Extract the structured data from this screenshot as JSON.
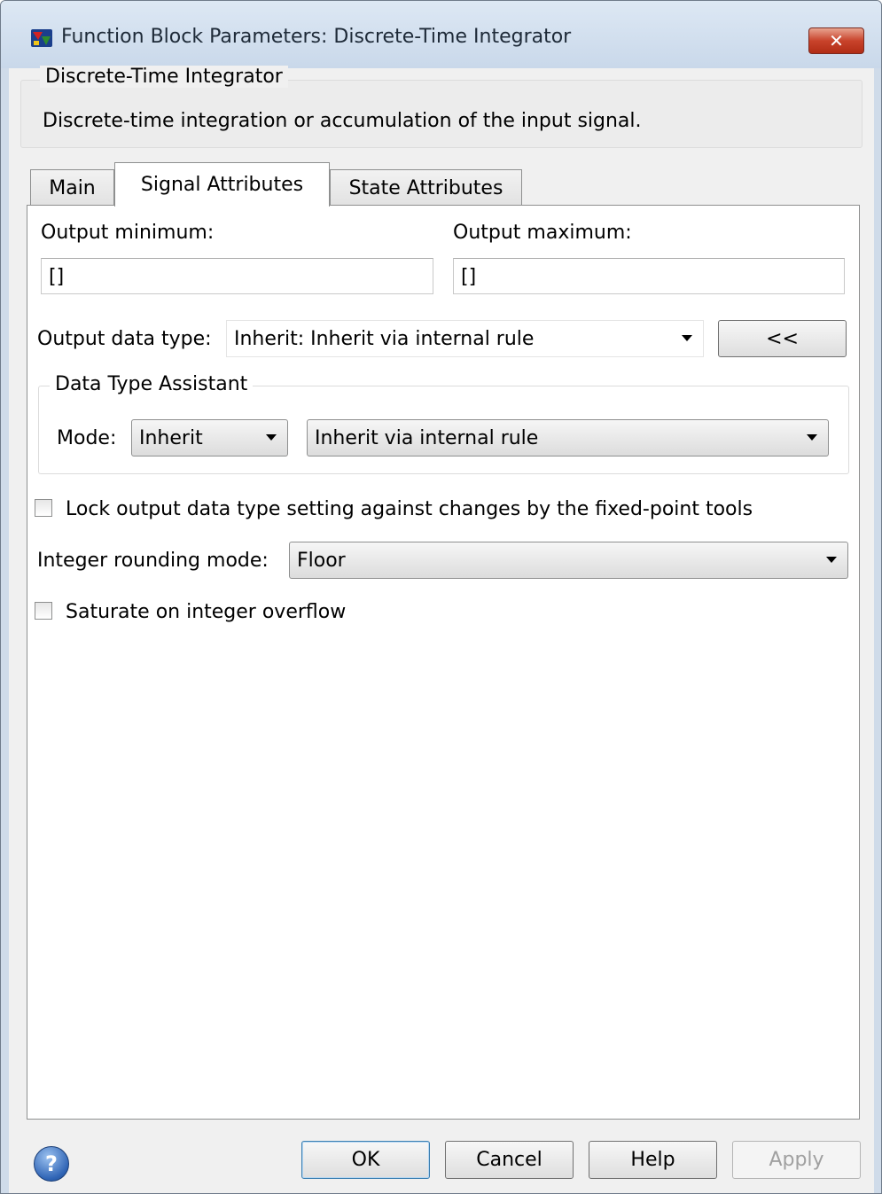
{
  "window": {
    "title": "Function Block Parameters: Discrete-Time Integrator",
    "close_glyph": "✕",
    "icon": "simulink-block-icon"
  },
  "description": {
    "group_label": "Discrete-Time Integrator",
    "text": "Discrete-time integration or accumulation of the input signal."
  },
  "tabs": [
    {
      "label": "Main",
      "active": false
    },
    {
      "label": "Signal Attributes",
      "active": true
    },
    {
      "label": "State Attributes",
      "active": false
    }
  ],
  "signal": {
    "output_min_label": "Output minimum:",
    "output_min_value": "[]",
    "output_max_label": "Output maximum:",
    "output_max_value": "[]",
    "output_dtype_label": "Output data type:",
    "output_dtype_value": "Inherit: Inherit via internal rule",
    "assistant_toggle_label": "<<",
    "assistant": {
      "label": "Data Type Assistant",
      "mode_label": "Mode:",
      "mode_value": "Inherit",
      "rule_value": "Inherit via internal rule"
    },
    "lock_label": "Lock output data type setting against changes by the fixed-point tools",
    "lock_checked": false,
    "rounding_label": "Integer rounding mode:",
    "rounding_value": "Floor",
    "saturate_label": "Saturate on integer overflow",
    "saturate_checked": false
  },
  "buttons": {
    "help_icon": "?",
    "ok": "OK",
    "cancel": "Cancel",
    "help": "Help",
    "apply": "Apply"
  }
}
